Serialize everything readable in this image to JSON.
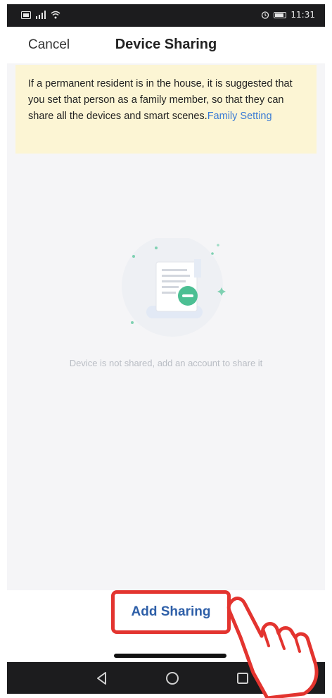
{
  "status_bar": {
    "time": "11:31"
  },
  "header": {
    "cancel_label": "Cancel",
    "title": "Device Sharing"
  },
  "notice": {
    "text": "If a permanent resident is in the house, it is suggested that you set that person as a family member, so that they can share all the devices and smart scenes.",
    "link_label": "Family Setting"
  },
  "empty_state": {
    "message": "Device is not shared, add an account to share it",
    "illustration_icon": "document-minus-icon"
  },
  "actions": {
    "add_sharing_label": "Add Sharing"
  },
  "nav": {
    "back_icon": "back-triangle-icon",
    "home_icon": "home-circle-icon",
    "recents_icon": "recents-square-icon"
  },
  "colors": {
    "notice_bg": "#fcf5d4",
    "link": "#3a7bd5",
    "button_text": "#2e5fa8",
    "highlight": "#e3342f",
    "illustration_accent": "#3bb58c"
  }
}
